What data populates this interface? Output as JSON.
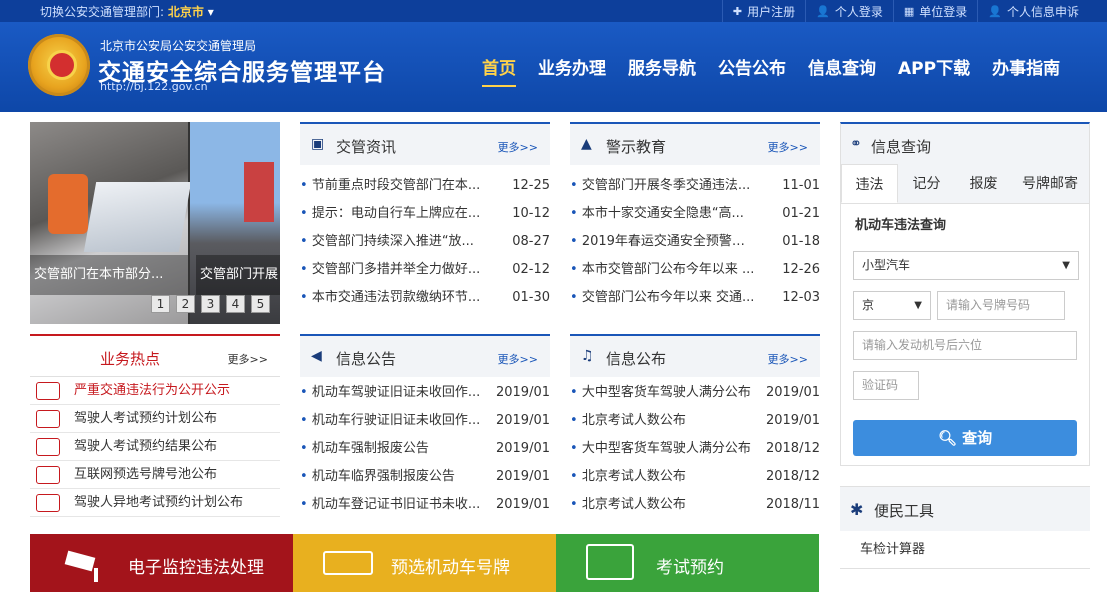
{
  "topbar": {
    "switch_label": "切换公安交通管理部门:",
    "city": "北京市",
    "links": [
      {
        "icon": "plus-icon",
        "label": "用户注册"
      },
      {
        "icon": "user-icon",
        "label": "个人登录"
      },
      {
        "icon": "building-icon",
        "label": "单位登录"
      },
      {
        "icon": "user-icon",
        "label": "个人信息申诉"
      }
    ]
  },
  "header": {
    "org": "北京市公安局公安交通管理局",
    "site_title": "交通安全综合服务管理平台",
    "url": "http://bj.122.gov.cn"
  },
  "nav": [
    "首页",
    "业务办理",
    "服务导航",
    "公告公布",
    "信息查询",
    "APP下载",
    "办事指南"
  ],
  "banner": {
    "captions": [
      "交管部门在本市部分...",
      "交管部门开展"
    ],
    "pages": [
      "1",
      "2",
      "3",
      "4",
      "5"
    ]
  },
  "news": {
    "title": "交管资讯",
    "more": "更多>>",
    "items": [
      {
        "t": "节前重点时段交管部门在本...",
        "d": "12-25"
      },
      {
        "t": "提示：电动自行车上牌应在...",
        "d": "10-12"
      },
      {
        "t": "交管部门持续深入推进“放...",
        "d": "08-27"
      },
      {
        "t": "交管部门多措并举全力做好...",
        "d": "02-12"
      },
      {
        "t": "本市交通违法罚款缴纳环节...",
        "d": "01-30"
      }
    ]
  },
  "warning": {
    "title": "警示教育",
    "more": "更多>>",
    "items": [
      {
        "t": "交管部门开展冬季交通违法...",
        "d": "11-01"
      },
      {
        "t": "本市十家交通安全隐患“高...",
        "d": "01-21"
      },
      {
        "t": "2019年春运交通安全预警：...",
        "d": "01-18"
      },
      {
        "t": "本市交管部门公布今年以来 ...",
        "d": "12-26"
      },
      {
        "t": "交管部门公布今年以来 交通...",
        "d": "12-03"
      }
    ]
  },
  "hot": {
    "title": "业务热点",
    "more": "更多>>",
    "items": [
      "严重交通违法行为公开公示",
      "驾驶人考试预约计划公布",
      "驾驶人考试预约结果公布",
      "互联网预选号牌号池公布",
      "驾驶人异地考试预约计划公布"
    ]
  },
  "notice": {
    "title": "信息公告",
    "more": "更多>>",
    "items": [
      {
        "t": "机动车驾驶证旧证未收回作...",
        "d": "2019/01"
      },
      {
        "t": "机动车行驶证旧证未收回作...",
        "d": "2019/01"
      },
      {
        "t": "机动车强制报废公告",
        "d": "2019/01"
      },
      {
        "t": "机动车临界强制报废公告",
        "d": "2019/01"
      },
      {
        "t": "机动车登记证书旧证书未收...",
        "d": "2019/01"
      }
    ]
  },
  "info": {
    "title": "信息公布",
    "more": "更多>>",
    "items": [
      {
        "t": "大中型客货车驾驶人满分公布",
        "d": "2019/01"
      },
      {
        "t": "北京考试人数公布",
        "d": "2019/01"
      },
      {
        "t": "大中型客货车驾驶人满分公布",
        "d": "2018/12"
      },
      {
        "t": "北京考试人数公布",
        "d": "2018/12"
      },
      {
        "t": "北京考试人数公布",
        "d": "2018/11"
      }
    ]
  },
  "query": {
    "title": "信息查询",
    "tabs": [
      "违法",
      "记分",
      "报废",
      "号牌邮寄"
    ],
    "subtitle": "机动车违法查询",
    "vehicle_type": "小型汽车",
    "province": "京",
    "plate_placeholder": "请输入号牌号码",
    "engine_placeholder": "请输入发动机号后六位",
    "captcha_placeholder": "验证码",
    "button": "查询"
  },
  "tools": {
    "title": "便民工具",
    "items": [
      "车检计算器"
    ]
  },
  "bottom": [
    {
      "label": "电子监控违法处理",
      "color": "#a3141b"
    },
    {
      "label": "预选机动车号牌",
      "color": "#e8b01f"
    },
    {
      "label": "考试预约",
      "color": "#3aa33b"
    }
  ]
}
